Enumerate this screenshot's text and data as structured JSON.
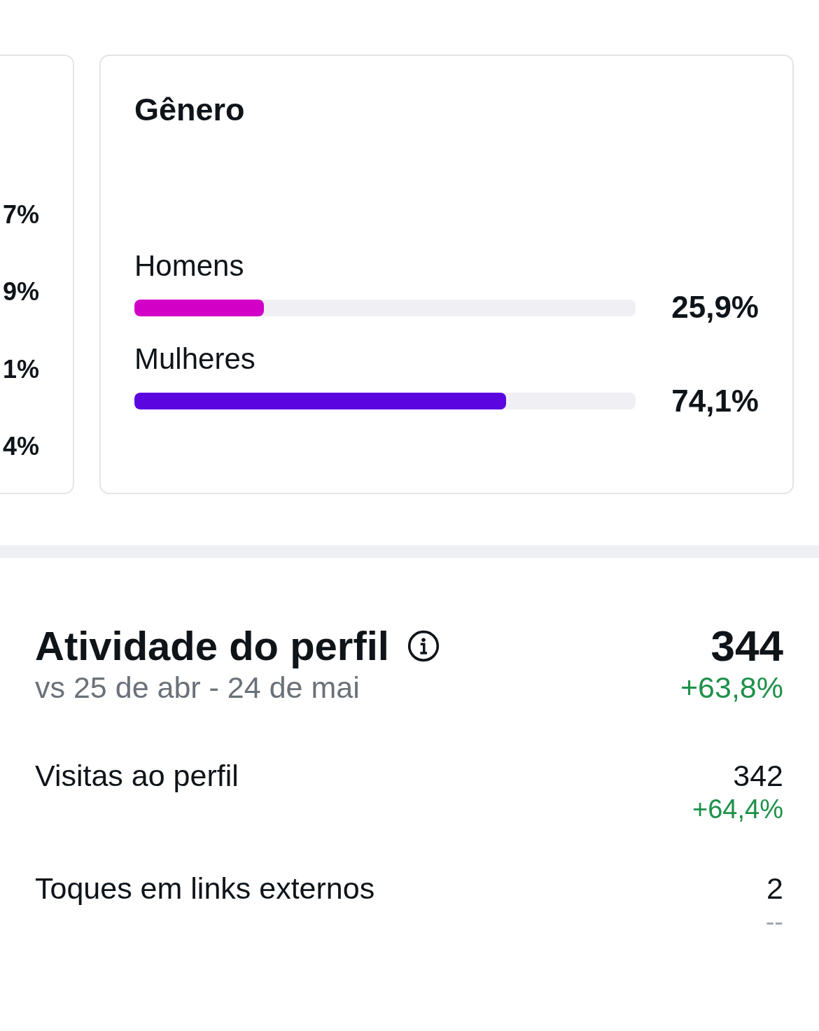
{
  "left_card": {
    "values": [
      "7%",
      "9%",
      "1%",
      "4%"
    ]
  },
  "gender_card": {
    "title": "Gênero",
    "rows": [
      {
        "label": "Homens",
        "level": 0.259,
        "value": "25,9%",
        "color": "#d200c6"
      },
      {
        "label": "Mulheres",
        "level": 0.741,
        "value": "74,1%",
        "color": "#5b06e0"
      }
    ]
  },
  "profile_activity": {
    "title": "Atividade do perfil",
    "comparison": "vs 25 de abr - 24 de mai",
    "total": "344",
    "change": {
      "text": "+63,8%",
      "kind": "increase"
    },
    "metrics": [
      {
        "label": "Visitas ao perfil",
        "value": "342",
        "change": {
          "text": "+64,4%",
          "kind": "increase"
        }
      },
      {
        "label": "Toques em links externos",
        "value": "2",
        "change": {
          "text": "--",
          "kind": "empty"
        }
      }
    ]
  }
}
